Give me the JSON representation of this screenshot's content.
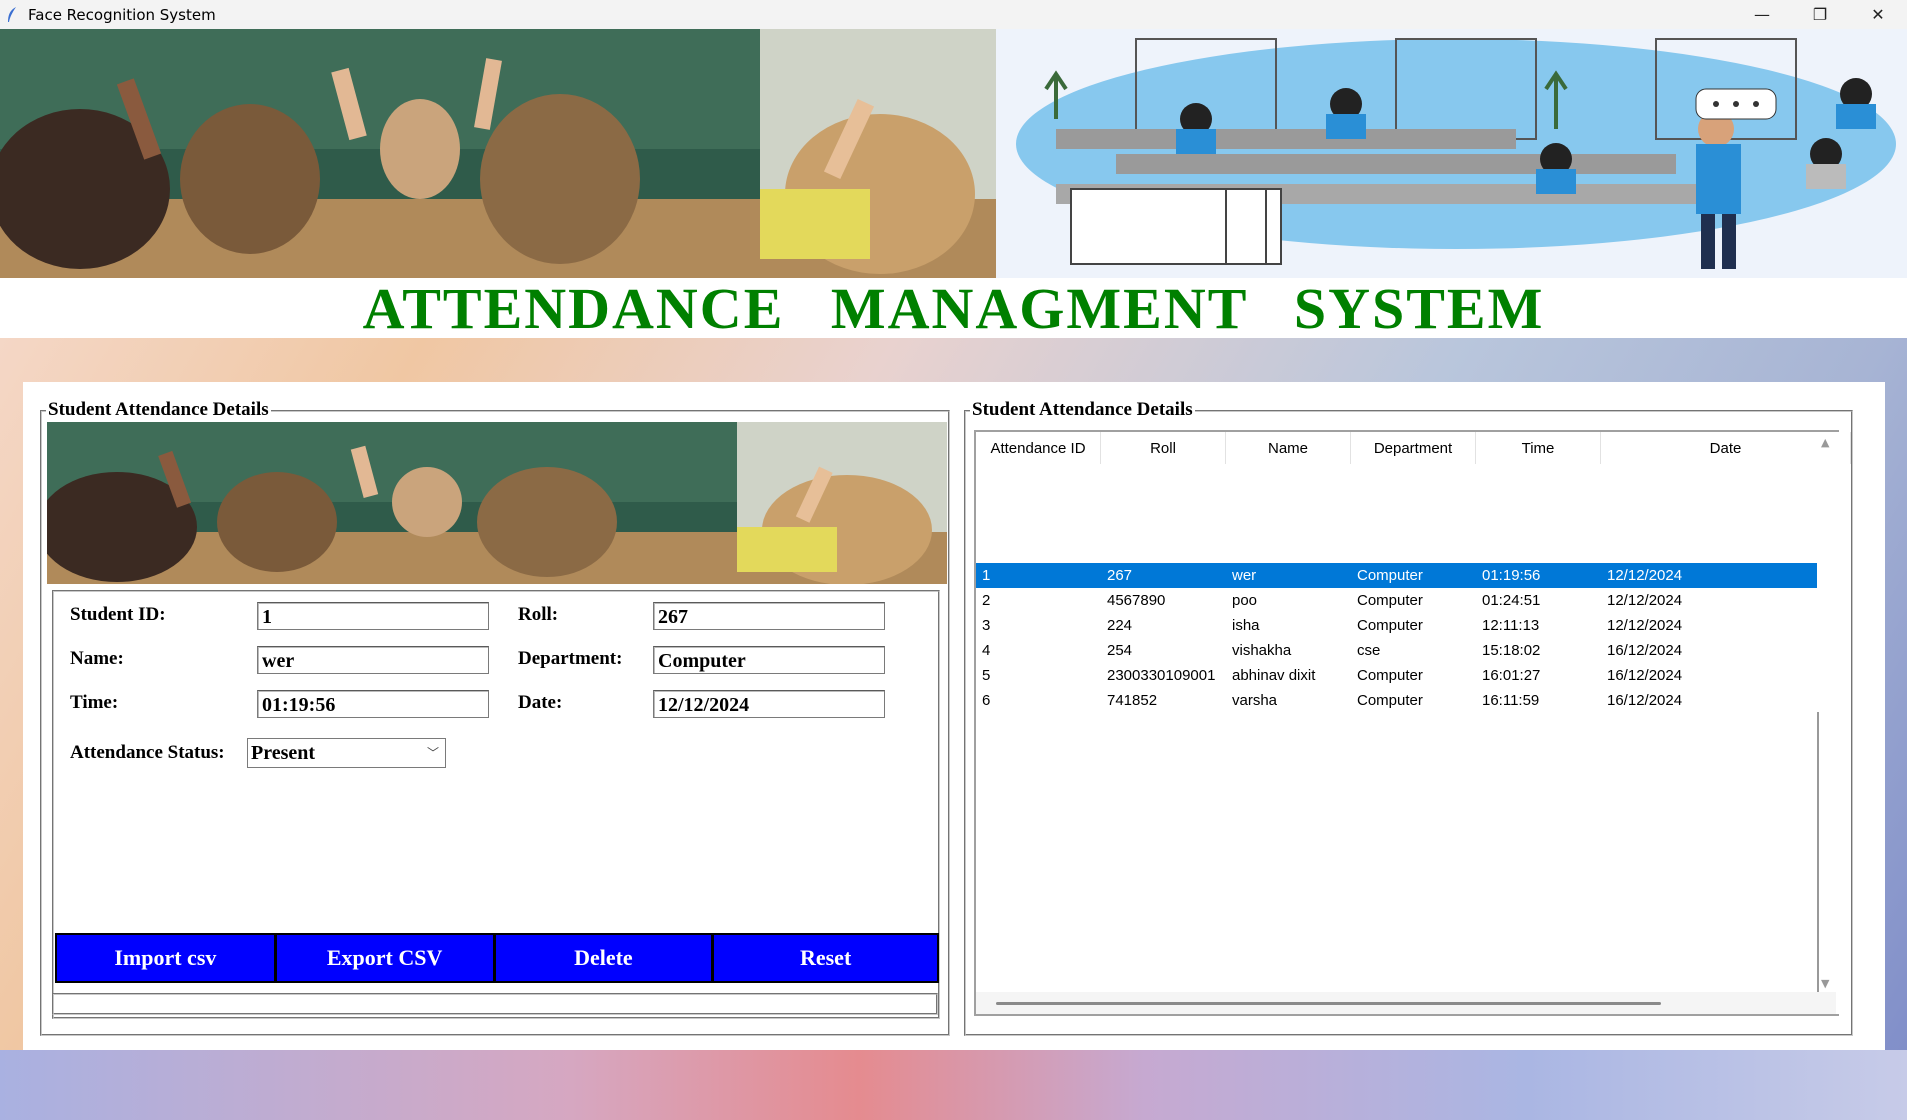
{
  "window": {
    "title": "Face Recognition System",
    "minimize": "—",
    "maximize": "❐",
    "close": "✕"
  },
  "heading": "ATTENDANCE MANAGMENT SYSTEM",
  "left_panel": {
    "legend": "Student Attendance Details",
    "fields": {
      "student_id_label": "Student ID:",
      "student_id_value": "1",
      "roll_label": "Roll:",
      "roll_value": "267",
      "name_label": "Name:",
      "name_value": "wer",
      "department_label": "Department:",
      "department_value": "Computer",
      "time_label": "Time:",
      "time_value": "01:19:56",
      "date_label": "Date:",
      "date_value": "12/12/2024",
      "status_label": "Attendance Status:",
      "status_value": "Present"
    },
    "buttons": {
      "import": "Import csv",
      "export": "Export CSV",
      "delete": "Delete",
      "reset": "Reset"
    }
  },
  "right_panel": {
    "legend": "Student  Attendance Details",
    "columns": [
      "Attendance ID",
      "Roll",
      "Name",
      "Department",
      "Time",
      "Date"
    ],
    "rows": [
      [
        "1",
        "267",
        "wer",
        "Computer",
        "01:19:56",
        "12/12/2024"
      ],
      [
        "2",
        "4567890",
        "poo",
        "Computer",
        "01:24:51",
        "12/12/2024"
      ],
      [
        "3",
        "224",
        "isha",
        "Computer",
        "12:11:13",
        "12/12/2024"
      ],
      [
        "4",
        "254",
        "vishakha",
        "cse",
        "15:18:02",
        "16/12/2024"
      ],
      [
        "5",
        "2300330109001",
        "abhinav dixit",
        "Computer",
        "16:01:27",
        "16/12/2024"
      ],
      [
        "6",
        "741852",
        "varsha",
        "Computer",
        "16:11:59",
        "16/12/2024"
      ]
    ],
    "selected_row": 0
  },
  "colors": {
    "heading": "#008000",
    "button": "#0000ff",
    "selection": "#0078d7"
  }
}
